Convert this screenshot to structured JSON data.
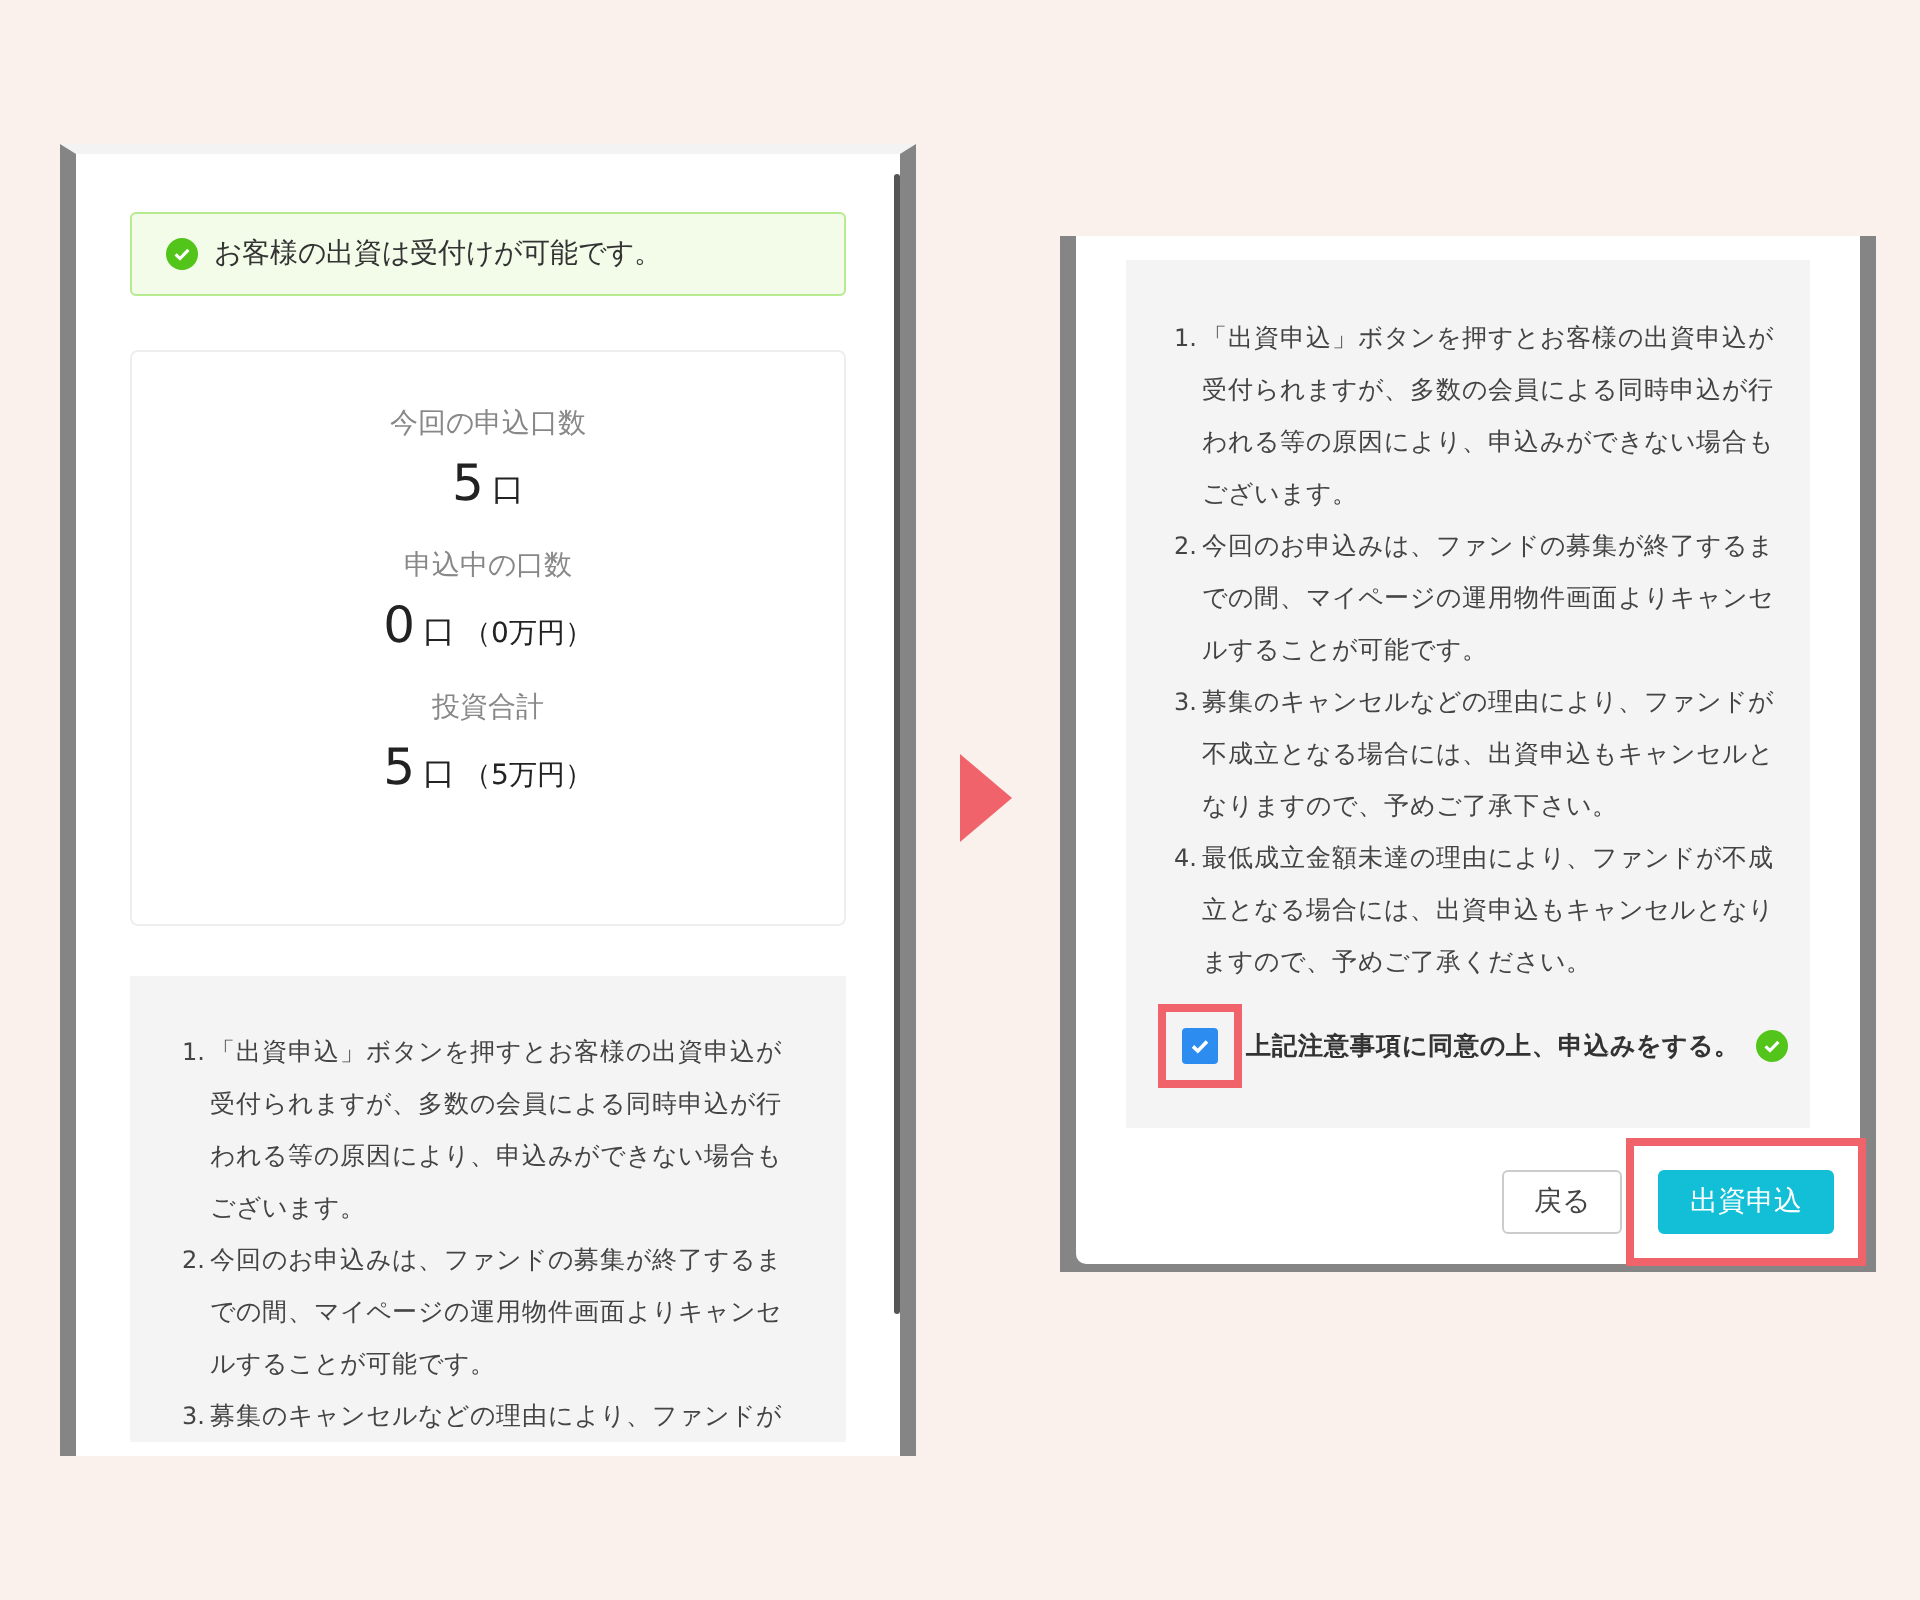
{
  "left_screen": {
    "alert": {
      "kind": "success",
      "text": "お客様の出資は受付けが可能です。"
    },
    "summary": [
      {
        "label": "今回の申込口数",
        "value": "5",
        "unit": "口"
      },
      {
        "label": "申込中の口数",
        "value": "0",
        "unit": "口",
        "amount": "（0万円）"
      },
      {
        "label": "投資合計",
        "value": "5",
        "unit": "口",
        "amount": "（5万円）"
      }
    ],
    "notes": [
      {
        "number": "1.",
        "text": "「出資申込」ボタンを押すとお客様の出資申込が受付られますが、多数の会員による同時申込が行われる等の原因により、申込みができない場合もございます。"
      },
      {
        "number": "2.",
        "text": "今回のお申込みは、ファンドの募集が終了するまでの間、マイページの運用物件画面よりキャンセルすることが可能です。"
      },
      {
        "number": "3.",
        "text": "募集のキャンセルなどの理由により、ファンドが"
      }
    ]
  },
  "right_screen": {
    "notes": [
      {
        "number": "1.",
        "text": "「出資申込」ボタンを押すとお客様の出資申込が受付られますが、多数の会員による同時申込が行われる等の原因により、申込みができない場合もございます。"
      },
      {
        "number": "2.",
        "text": "今回のお申込みは、ファンドの募集が終了するまでの間、マイページの運用物件画面よりキャンセルすることが可能です。"
      },
      {
        "number": "3.",
        "text": "募集のキャンセルなどの理由により、ファンドが不成立となる場合には、出資申込もキャンセルとなりますので、予めご了承下さい。"
      },
      {
        "number": "4.",
        "text": "最低成立金額未達の理由により、ファンドが不成立となる場合には、出資申込もキャンセルとなりますので、予めご了承ください。"
      }
    ],
    "agreement": {
      "label": "上記注意事項に同意の上、申込みをする。",
      "checked": true,
      "highlighted": true,
      "valid": true
    },
    "buttons": [
      {
        "label": "戻る",
        "kind": "secondary",
        "highlighted": false
      },
      {
        "label": "出資申込",
        "kind": "primary",
        "highlighted": true
      }
    ]
  }
}
